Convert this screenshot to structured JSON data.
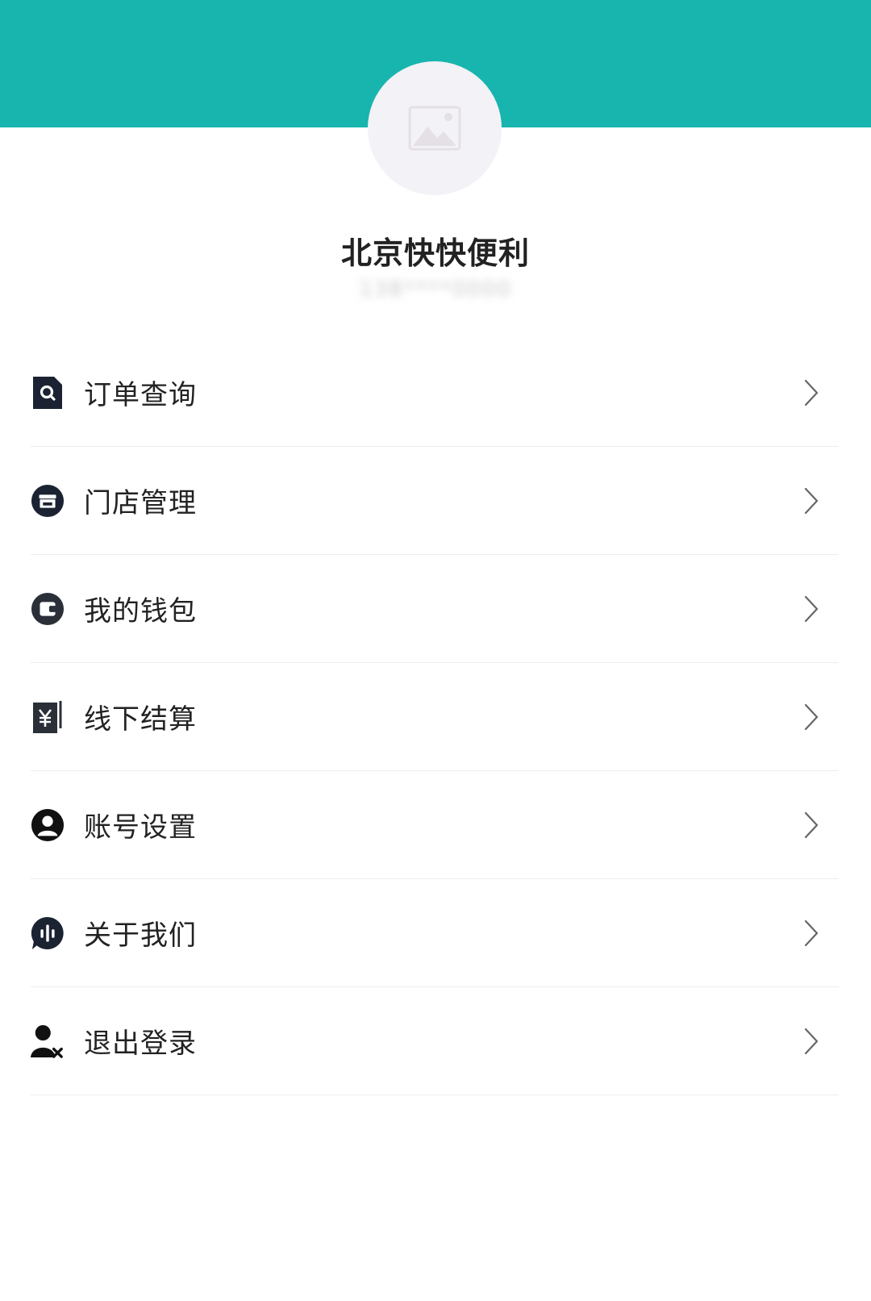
{
  "header": {
    "color": "#17b5ae"
  },
  "profile": {
    "avatar_icon": "image-placeholder-icon",
    "store_name": "北京快快便利",
    "sub_text_blurred": "138****0000"
  },
  "menu": {
    "items": [
      {
        "label": "订单查询",
        "icon": "order-search-icon"
      },
      {
        "label": "门店管理",
        "icon": "store-icon"
      },
      {
        "label": "我的钱包",
        "icon": "wallet-icon"
      },
      {
        "label": "线下结算",
        "icon": "yuan-bill-icon"
      },
      {
        "label": "账号设置",
        "icon": "user-account-icon"
      },
      {
        "label": "关于我们",
        "icon": "about-chat-icon"
      },
      {
        "label": "退出登录",
        "icon": "logout-user-icon"
      }
    ]
  }
}
